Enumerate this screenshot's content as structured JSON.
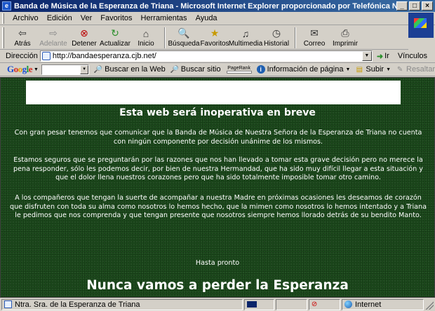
{
  "window": {
    "title": "Banda de Música de la Esperanza de Triana - Microsoft Internet Explorer proporcionado por Telefónica Net",
    "buttons": {
      "minimize": "_",
      "maximize": "□",
      "close": "×"
    }
  },
  "menu": [
    "Archivo",
    "Edición",
    "Ver",
    "Favoritos",
    "Herramientas",
    "Ayuda"
  ],
  "toolbar": {
    "back": "Atrás",
    "forward": "Adelante",
    "stop": "Detener",
    "refresh": "Actualizar",
    "home": "Inicio",
    "search": "Búsqueda",
    "favorites": "Favoritos",
    "media": "Multimedia",
    "history": "Historial",
    "mail": "Correo",
    "print": "Imprimir"
  },
  "address": {
    "label": "Dirección",
    "url": "http://bandaesperanza.cjb.net/",
    "go": "Ir",
    "links": "Vínculos"
  },
  "google": {
    "search_web": "Buscar en la Web",
    "search_site": "Buscar sitio",
    "pagerank": "PageRank",
    "page_info": "Información de página",
    "up": "Subir",
    "highlight": "Resaltar"
  },
  "page": {
    "headline": "Esta web será inoperativa en breve",
    "paragraphs": [
      "Con gran pesar tenemos que comunicar que la Banda de Música de Nuestra Señora de la Esperanza de Triana no cuenta con ningún componente por decisión unánime de los mismos.",
      "Estamos seguros que se preguntarán por las razones que nos han llevado a tomar esta grave decisión pero no merece la pena responder, sólo les podemos decir, por bien de nuestra Hermandad, que ha sido muy difícil llegar a esta situación y que el dolor llena nuestros corazones pero que ha sido totalmente imposible tomar otro camino.",
      "A los compañeros que tengan la suerte de acompañar a nuestra Madre en próximas ocasiones les deseamos de corazón que disfruten con toda su alma como nosotros lo hemos hecho, que la mimen como nosotros lo hemos intentado y a Triana le pedimos que nos comprenda y que tengan presente que nosotros siempre hemos llorado detrás de su bendito Manto."
    ],
    "farewell": "Hasta pronto",
    "motto": "Nunca vamos a perder la Esperanza"
  },
  "status": {
    "text": "Ntra. Sra. de la Esperanza de Triana",
    "zone": "Internet"
  }
}
